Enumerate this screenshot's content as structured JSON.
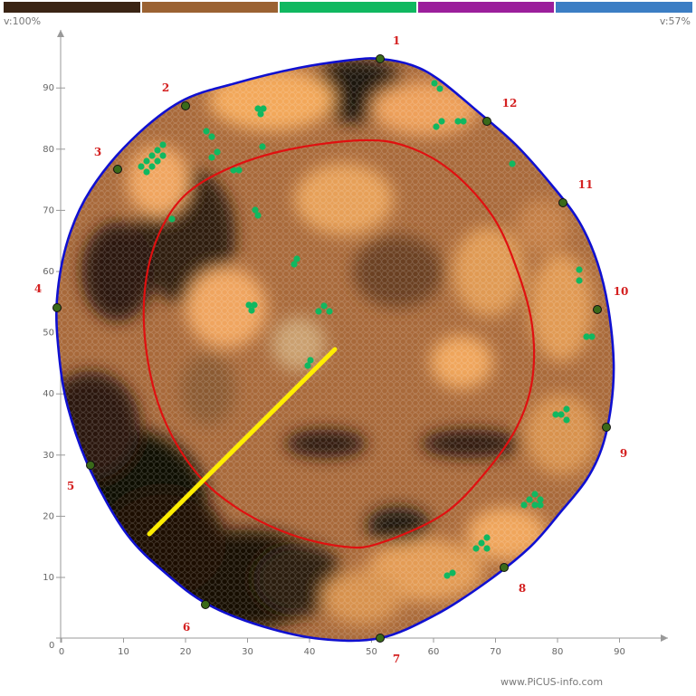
{
  "colorbar": {
    "segments": [
      "#3a2414",
      "#9b6232",
      "#10b860",
      "#9b1f9b",
      "#3c7ec4"
    ]
  },
  "scale": {
    "left_label": "v:100%",
    "right_label": "v:57%"
  },
  "axes": {
    "x_ticks": [
      "0",
      "10",
      "20",
      "30",
      "40",
      "50",
      "60",
      "70",
      "80",
      "90"
    ],
    "y_ticks": [
      "10",
      "20",
      "30",
      "40",
      "50",
      "60",
      "70",
      "80",
      "90"
    ],
    "origin_label": "0"
  },
  "sensors": [
    "1",
    "2",
    "3",
    "4",
    "5",
    "6",
    "7",
    "8",
    "9",
    "10",
    "11",
    "12"
  ],
  "colors": {
    "outline": "#1010d0",
    "damage_contour": "#e01010",
    "measurement_line": "#ffee00",
    "healthy_light": "#f2a55a",
    "decayed_dark": "#120a04",
    "green_patch": "#10b860",
    "sensor_label": "#d42020"
  },
  "footer": "www.PiCUS-info.com"
}
